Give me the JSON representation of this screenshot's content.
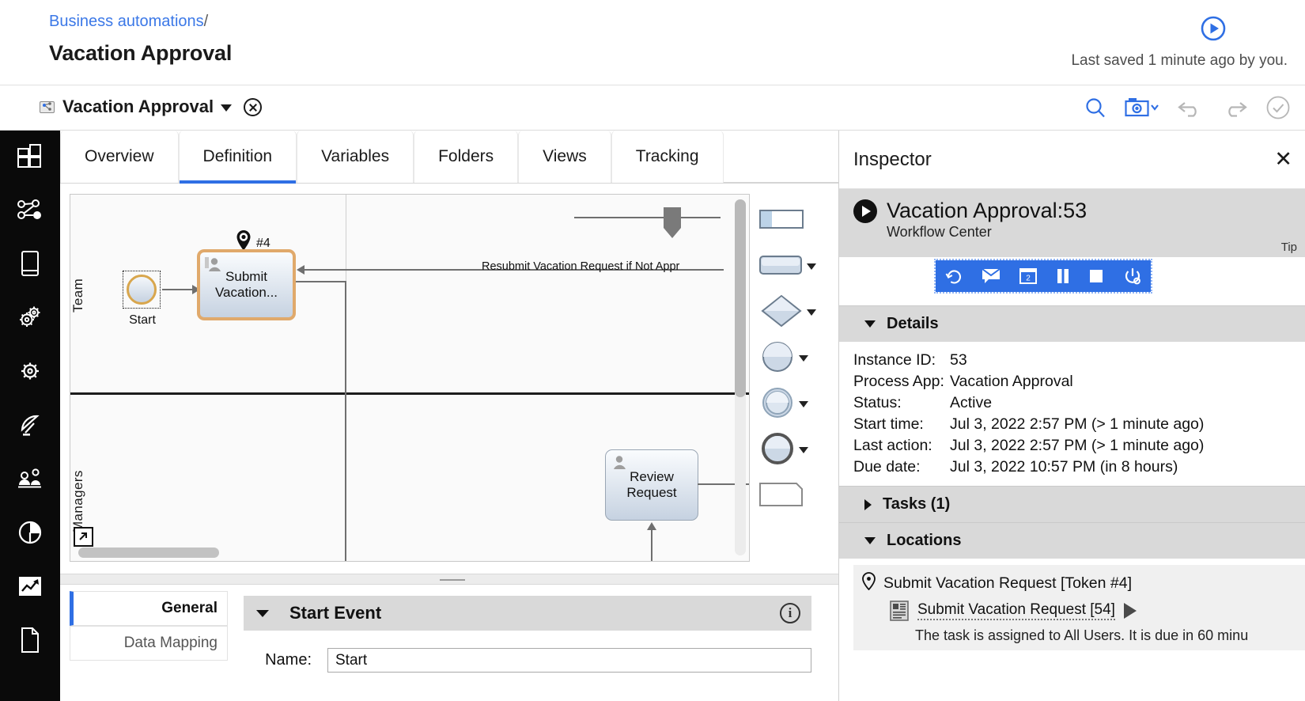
{
  "header": {
    "breadcrumb_link": "Business automations",
    "breadcrumb_sep": "/",
    "page_title": "Vacation Approval",
    "saved_note": "Last saved 1 minute ago by you.",
    "run_icon": "play-circle-icon"
  },
  "subbar": {
    "process_name": "Vacation Approval",
    "process_icon": "process-app-icon",
    "dropdown_icon": "chevron-down-icon",
    "close_icon": "close-circle-icon",
    "tools": [
      {
        "name": "search-icon",
        "label": "Search"
      },
      {
        "name": "snapshot-icon",
        "label": "Snapshot"
      },
      {
        "name": "undo-icon",
        "label": "Undo"
      },
      {
        "name": "redo-icon",
        "label": "Redo"
      },
      {
        "name": "validate-icon",
        "label": "Validate"
      }
    ]
  },
  "rail": {
    "items": [
      {
        "icon": "dashboard-grid-icon",
        "label": "Dashboard"
      },
      {
        "icon": "process-share-icon",
        "label": "Processes"
      },
      {
        "icon": "mobile-app-icon",
        "label": "Apps"
      },
      {
        "icon": "gears-icon",
        "label": "Services"
      },
      {
        "icon": "gear-icon",
        "label": "Settings"
      },
      {
        "icon": "satellite-dish-icon",
        "label": "Events"
      },
      {
        "icon": "team-users-icon",
        "label": "Teams"
      },
      {
        "icon": "pie-chart-icon",
        "label": "Reports"
      },
      {
        "icon": "trending-chart-icon",
        "label": "Analytics"
      },
      {
        "icon": "document-icon",
        "label": "Documents"
      }
    ]
  },
  "editor": {
    "tabs": [
      {
        "label": "Overview",
        "active": false
      },
      {
        "label": "Definition",
        "active": true
      },
      {
        "label": "Variables",
        "active": false
      },
      {
        "label": "Folders",
        "active": false
      },
      {
        "label": "Views",
        "active": false
      },
      {
        "label": "Tracking",
        "active": false
      }
    ]
  },
  "diagram": {
    "lanes": [
      {
        "label": "Team"
      },
      {
        "label": "Managers"
      }
    ],
    "nodes": [
      {
        "id": "start",
        "type": "start-event",
        "label": "Start",
        "selected": true
      },
      {
        "id": "submit",
        "type": "user-task",
        "label": "Submit Vacation...",
        "token_badge": "#4",
        "highlighted": true
      },
      {
        "id": "review",
        "type": "user-task",
        "label": "Review Request",
        "highlighted": false
      }
    ],
    "connector_labels": [
      "Resubmit Vacation Request if Not Appr"
    ],
    "expand_icon": "expand-lane-icon"
  },
  "palette": {
    "items": [
      {
        "icon": "swimlane-shape-icon",
        "label": "Swimlane",
        "has_menu": false
      },
      {
        "icon": "activity-shape-icon",
        "label": "Activity",
        "has_menu": true
      },
      {
        "icon": "gateway-shape-icon",
        "label": "Gateway",
        "has_menu": true
      },
      {
        "icon": "start-event-shape-icon",
        "label": "Start event",
        "has_menu": true
      },
      {
        "icon": "intermediate-event-shape-icon",
        "label": "Intermediate event",
        "has_menu": true
      },
      {
        "icon": "end-event-shape-icon",
        "label": "End event",
        "has_menu": true
      },
      {
        "icon": "note-shape-icon",
        "label": "Note",
        "has_menu": false
      }
    ]
  },
  "properties": {
    "tabs": [
      {
        "label": "General",
        "active": true
      },
      {
        "label": "Data Mapping",
        "active": false
      }
    ],
    "section_title": "Start Event",
    "info_icon": "info-icon",
    "collapse_icon": "chevron-down-icon",
    "name_label": "Name:",
    "name_value": "Start",
    "name_placeholder": ""
  },
  "inspector": {
    "title": "Inspector",
    "close_icon": "close-icon",
    "instance_name": "Vacation Approval:53",
    "instance_sub": "Workflow Center",
    "tip_label": "Tip",
    "actions": [
      {
        "icon": "retry-icon",
        "label": "Retry"
      },
      {
        "icon": "message-icon",
        "label": "Send message"
      },
      {
        "icon": "step-icon",
        "label": "Step"
      },
      {
        "icon": "pause-icon",
        "label": "Pause"
      },
      {
        "icon": "stop-icon",
        "label": "Stop"
      },
      {
        "icon": "power-icon",
        "label": "Terminate"
      }
    ],
    "details": {
      "title": "Details",
      "expanded": true,
      "rows": [
        {
          "key": "Instance ID:",
          "value": "53"
        },
        {
          "key": "Process App:",
          "value": "Vacation Approval"
        },
        {
          "key": "Status:",
          "value": "Active"
        },
        {
          "key": "Start time:",
          "value": "Jul 3, 2022 2:57 PM (> 1 minute ago)"
        },
        {
          "key": "Last action:",
          "value": "Jul 3, 2022 2:57 PM (> 1 minute ago)"
        },
        {
          "key": "Due date:",
          "value": "Jul 3, 2022 10:57 PM (in 8 hours)"
        }
      ]
    },
    "tasks": {
      "title": "Tasks  (1)",
      "expanded": false
    },
    "locations": {
      "title": "Locations",
      "expanded": true,
      "token_icon": "location-pin-icon",
      "token_label": "Submit Vacation Request [Token #4]",
      "task_icon": "task-document-icon",
      "task_label": "Submit Vacation Request [54]",
      "task_play_icon": "play-triangle-icon",
      "task_note": "The task is assigned to All Users. It is due in 60 minu"
    }
  },
  "colors": {
    "accent": "#2f6fe4",
    "link": "#3b78e7",
    "rail_bg": "#0a0a0a",
    "section_bg": "#d9d9d9",
    "node_highlight": "#e0a96b"
  }
}
